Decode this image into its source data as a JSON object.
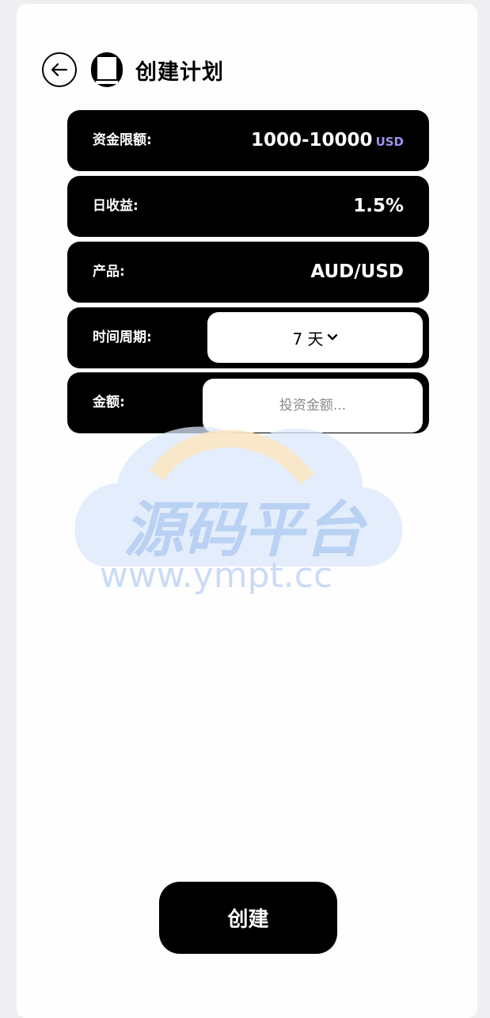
{
  "header": {
    "title": "创建计划",
    "back_icon": "arrow-left-icon",
    "logo_icon": "box-logo-icon"
  },
  "rows": {
    "limit": {
      "label": "资金限额:",
      "value": "1000-10000",
      "unit": "USD"
    },
    "daily_yield": {
      "label": "日收益:",
      "value": "1.5%"
    },
    "product": {
      "label": "产品:",
      "value": "AUD/USD"
    },
    "period": {
      "label": "时间周期:",
      "selected": "7 天"
    },
    "amount": {
      "label": "金额:",
      "placeholder": "投资金额...",
      "value": ""
    }
  },
  "watermark": {
    "text": "源码平台",
    "url": "www.ympt.cc"
  },
  "actions": {
    "create_label": "创建"
  },
  "colors": {
    "accent_unit": "#9d94ee",
    "row_bg": "#000000",
    "card_bg": "#fefefe",
    "page_bg": "#efeff1"
  }
}
